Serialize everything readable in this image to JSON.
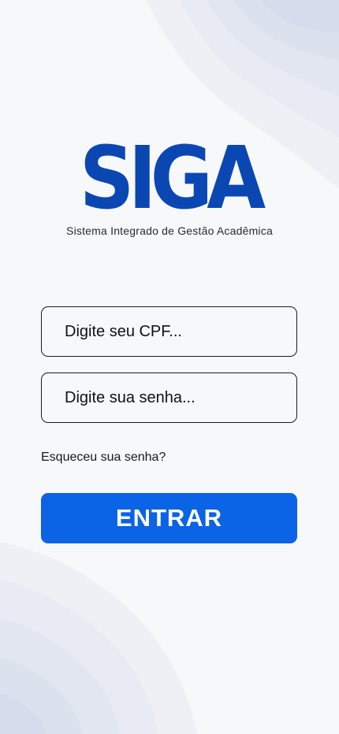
{
  "logo": {
    "wordmark": "SIGA",
    "subtitle": "Sistema Integrado de Gestão Acadêmica"
  },
  "form": {
    "cpf_placeholder": "Digite seu CPF...",
    "password_placeholder": "Digite sua senha...",
    "forgot_label": "Esqueceu sua senha?",
    "submit_label": "ENTRAR"
  },
  "colors": {
    "brand": "#0b47b3",
    "button": "#0b63e5",
    "background": "#f7f8fa"
  }
}
